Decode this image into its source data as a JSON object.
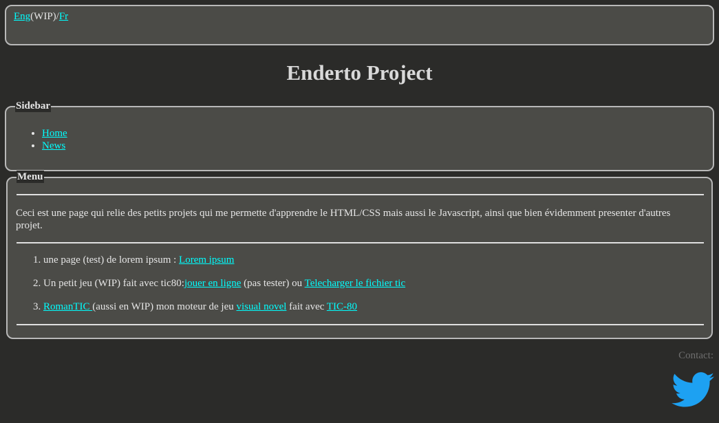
{
  "lang": {
    "eng": "Eng",
    "wip": "(WIP)/",
    "fr": "Fr"
  },
  "title": "Enderto Project",
  "sidebar": {
    "legend": "Sidebar",
    "items": [
      {
        "label": "Home"
      },
      {
        "label": "News"
      }
    ]
  },
  "menu": {
    "legend": "Menu",
    "description": "Ceci est une page qui relie des petits projets qui me permette d'apprendre le HTML/CSS mais aussi le Javascript, ainsi que bien évidemment presenter d'autres projet.",
    "items": [
      {
        "t1": "une page (test) de lorem ipsum : ",
        "l1": "Lorem ipsum"
      },
      {
        "t1": "Un petit jeu (WIP) fait avec tic80:",
        "l1": "jouer en ligne",
        "t2": " (pas tester) ou ",
        "l2": "Telecharger le fichier tic"
      },
      {
        "l1": "RomanTIC ",
        "t1": "(aussi en WIP) mon moteur de jeu ",
        "l2": "visual novel",
        "t2": " fait avec ",
        "l3": "TIC-80"
      }
    ]
  },
  "contact": {
    "label": "Contact:",
    "icon": "twitter-icon",
    "color": "#1da1f2"
  }
}
